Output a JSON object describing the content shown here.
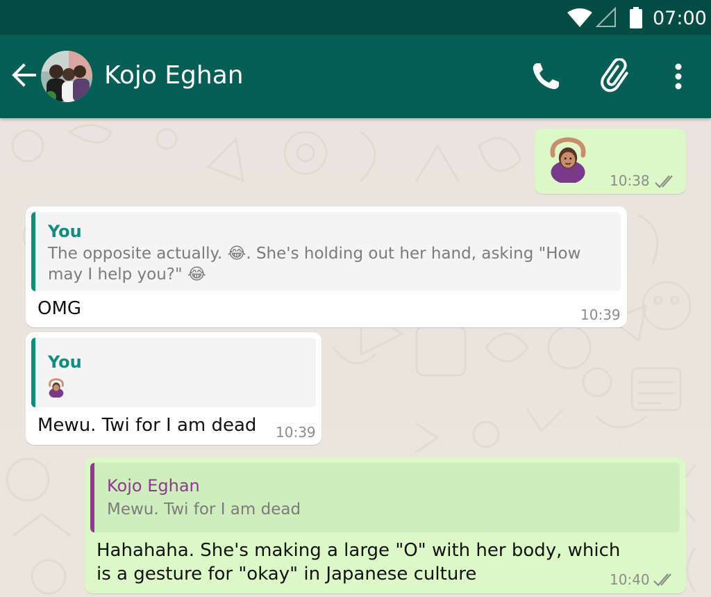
{
  "status_bar": {
    "time": "07:00"
  },
  "header": {
    "contact_name": "Kojo Eghan"
  },
  "messages": [
    {
      "direction": "out",
      "time": "10:38",
      "content_icon": "woman-gesturing-ok-emoji"
    },
    {
      "direction": "in",
      "quote": {
        "author": "You",
        "text": "The opposite actually. 😂. She's holding out her hand, asking \"How may I help you?\" 😂"
      },
      "text": "OMG",
      "time": "10:39"
    },
    {
      "direction": "in",
      "quote": {
        "author": "You",
        "text_icon": "woman-gesturing-ok-emoji"
      },
      "text": "Mewu. Twi for I am dead",
      "time": "10:39"
    },
    {
      "direction": "out",
      "quote": {
        "author": "Kojo Eghan",
        "text": "Mewu. Twi for I am dead"
      },
      "text": "Hahahaha. She's making a large \"O\" with her body, which is a gesture for \"okay\" in Japanese culture",
      "time": "10:40"
    }
  ],
  "colors": {
    "status_bar": "#054d44",
    "app_bar": "#075e54",
    "outgoing_bubble": "#dcf8c6",
    "incoming_bubble": "#ffffff",
    "quote_you": "#128c7e",
    "quote_contact": "#8e3a8e",
    "read_ticks": "#8c8c8c"
  }
}
